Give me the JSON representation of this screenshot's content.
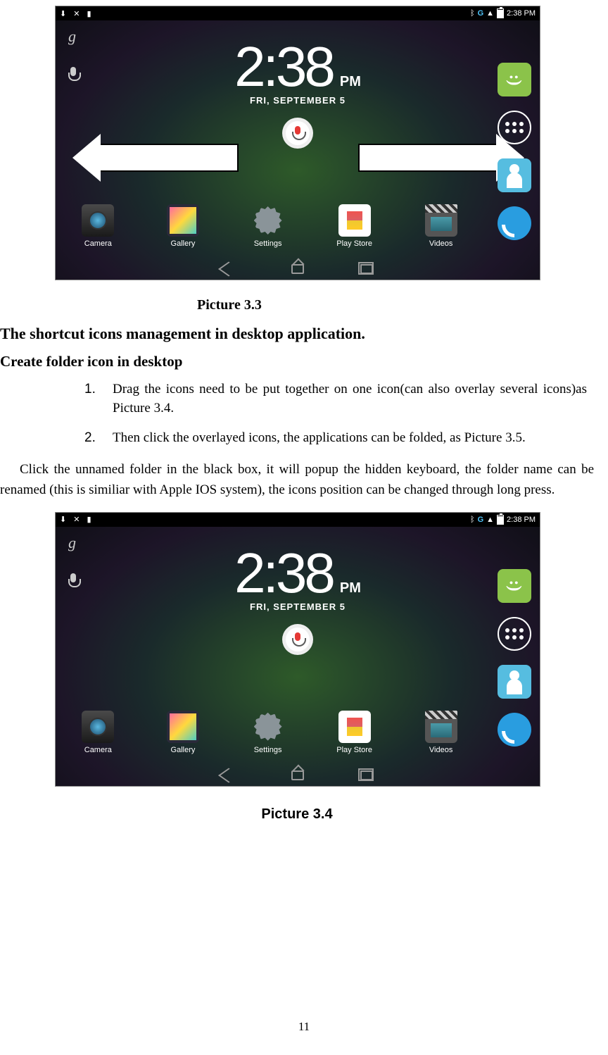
{
  "statusbar": {
    "time": "2:38 PM",
    "net_label": "G"
  },
  "clock": {
    "time": "2:38",
    "ampm": "PM",
    "date": "FRI, SEPTEMBER 5"
  },
  "apps": [
    {
      "label": "Camera"
    },
    {
      "label": "Gallery"
    },
    {
      "label": "Settings"
    },
    {
      "label": "Play Store"
    },
    {
      "label": "Videos"
    }
  ],
  "captions": {
    "pic33": "Picture 3.3",
    "pic34": "Picture 3.4"
  },
  "headings": {
    "main": "The shortcut icons management in desktop application.",
    "sub": "Create folder icon in desktop"
  },
  "list": {
    "item1_num": "1.",
    "item1": "Drag the icons need to be put together on one icon(can also overlay several icons)as Picture 3.4.",
    "item2_num": "2.",
    "item2": "Then click the overlayed icons, the applications can be folded, as Picture 3.5."
  },
  "paragraph": "Click the unnamed folder in the black box, it will popup the hidden keyboard, the folder name can be renamed (this is similiar with Apple IOS system), the icons position can be changed through long press.",
  "page_number": "11"
}
